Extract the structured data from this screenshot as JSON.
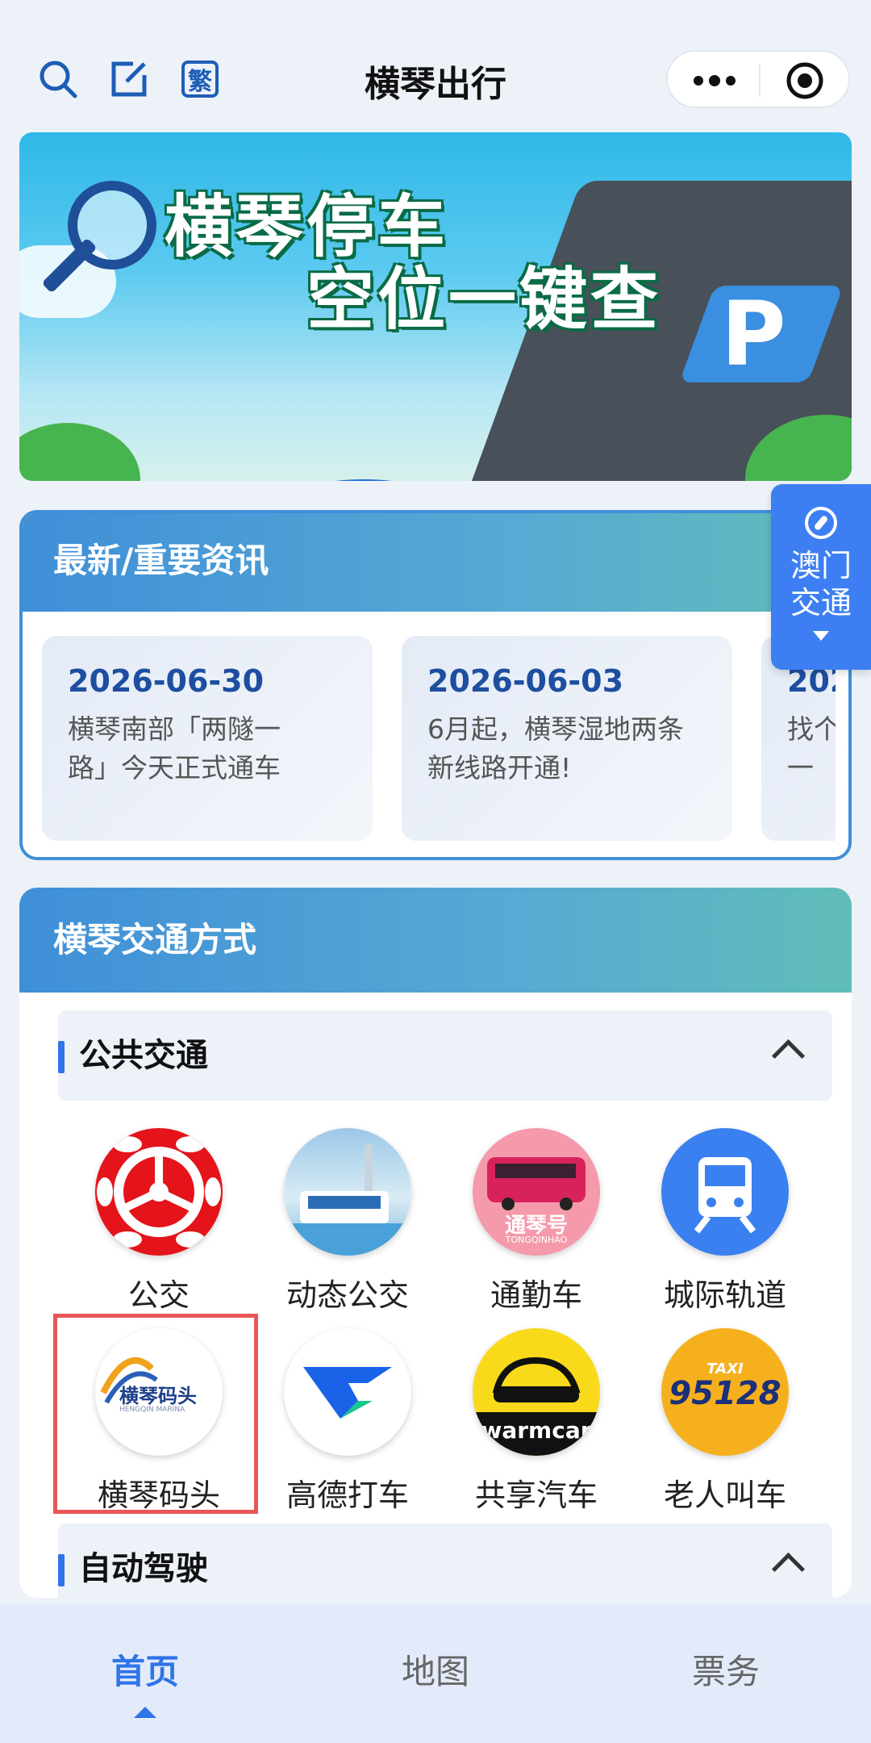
{
  "nav": {
    "title": "横琴出行",
    "traditional_label": "繁",
    "icons": [
      "search-icon",
      "edit-icon",
      "traditional-chinese-icon",
      "more-icon",
      "target-icon"
    ]
  },
  "banner": {
    "line1": "横琴停车",
    "line2": "空位一键查",
    "p_letter": "P"
  },
  "macau_button": {
    "line1": "澳门",
    "line2": "交通"
  },
  "news": {
    "title": "最新/重要资讯",
    "items": [
      {
        "date": "2026-06-30",
        "line1": "横琴南部「两隧一",
        "line2": "路」今天正式通车"
      },
      {
        "date": "2026-06-03",
        "line1": "6月起，横琴湿地两条",
        "line2": "新线路开通!"
      },
      {
        "date": "202",
        "line1": "找个",
        "line2": "一"
      }
    ]
  },
  "transport": {
    "title": "横琴交通方式",
    "public": {
      "title": "公共交通",
      "items": [
        {
          "label": "公交"
        },
        {
          "label": "动态公交"
        },
        {
          "label": "通勤车",
          "logo_text": "通琴号",
          "logo_sub": "TONGQINHAO"
        },
        {
          "label": "城际轨道"
        },
        {
          "label": "横琴码头",
          "logo_text": "横琴码头",
          "logo_sub": "HENGQIN MARINA"
        },
        {
          "label": "高德打车"
        },
        {
          "label": "共享汽车",
          "logo_text": "warmcar"
        },
        {
          "label": "老人叫车",
          "logo_text": "95128",
          "logo_sub": "TAXI"
        }
      ]
    },
    "autonomous": {
      "title": "自动驾驶"
    }
  },
  "tabs": [
    {
      "label": "首页"
    },
    {
      "label": "地图"
    },
    {
      "label": "票务"
    }
  ],
  "colors": {
    "accent": "#2f74e8",
    "dark_blue": "#1d4ea0",
    "highlight_box": "#e95656"
  }
}
